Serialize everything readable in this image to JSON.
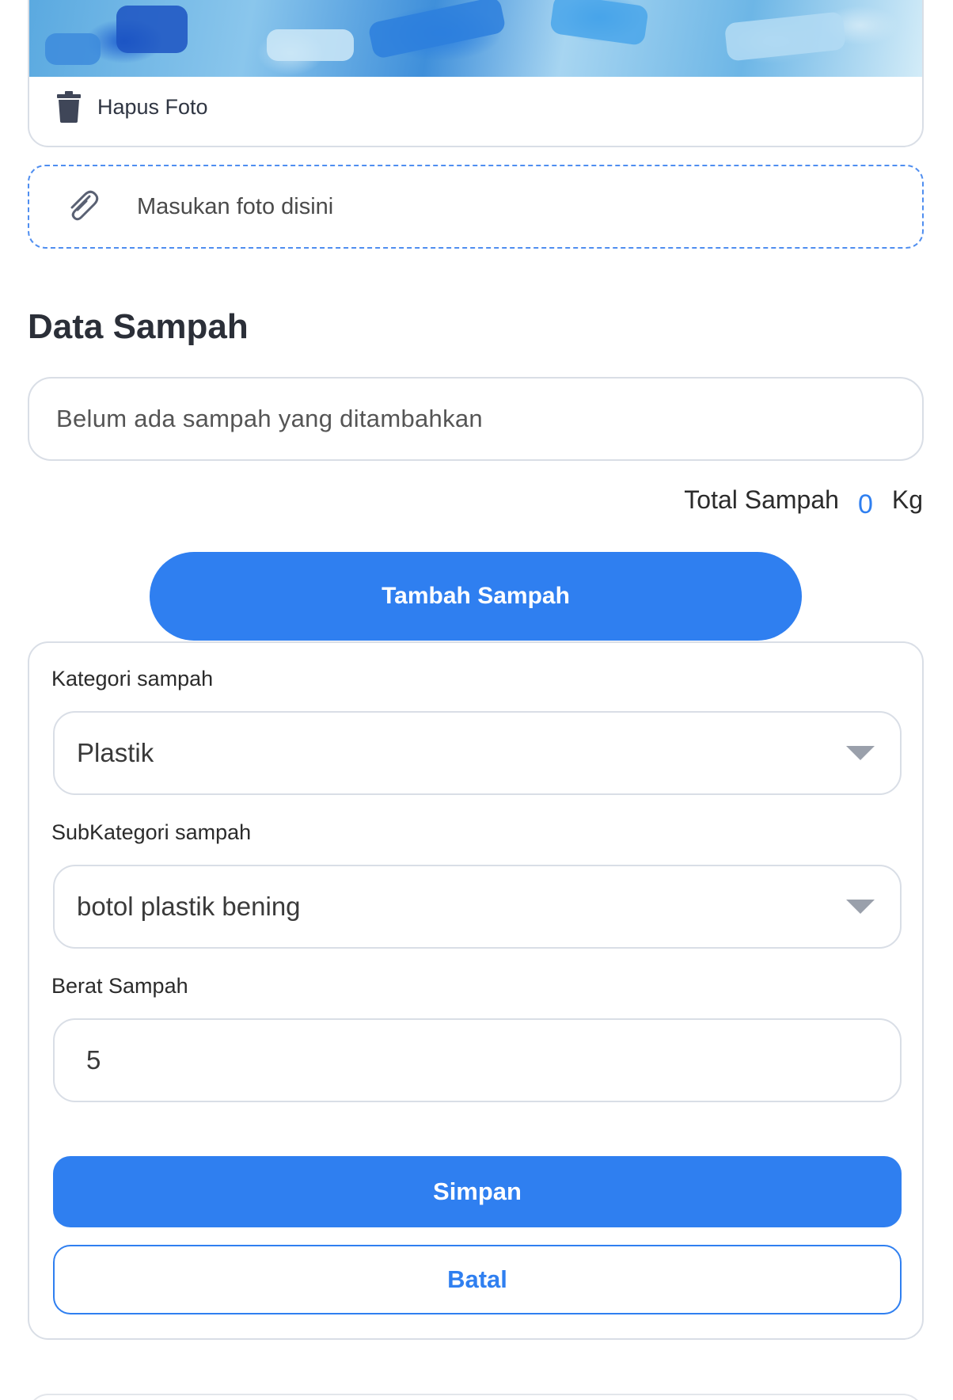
{
  "photo": {
    "delete_label": "Hapus Foto"
  },
  "upload": {
    "label": "Masukan foto disini"
  },
  "section": {
    "title": "Data Sampah"
  },
  "waste_list": {
    "empty_text": "Belum ada sampah yang ditambahkan"
  },
  "total": {
    "label": "Total Sampah",
    "value": "0",
    "unit": "Kg"
  },
  "add_button": {
    "label": "Tambah Sampah"
  },
  "form": {
    "category": {
      "label": "Kategori sampah",
      "value": "Plastik"
    },
    "subcategory": {
      "label": "SubKategori sampah",
      "value": "botol plastik bening"
    },
    "weight": {
      "label": "Berat Sampah",
      "value": "5"
    },
    "save_label": "Simpan",
    "cancel_label": "Batal"
  },
  "colors": {
    "accent": "#2f7ff0",
    "border": "#d9dee6",
    "dashed_border": "#4f8ef0"
  }
}
